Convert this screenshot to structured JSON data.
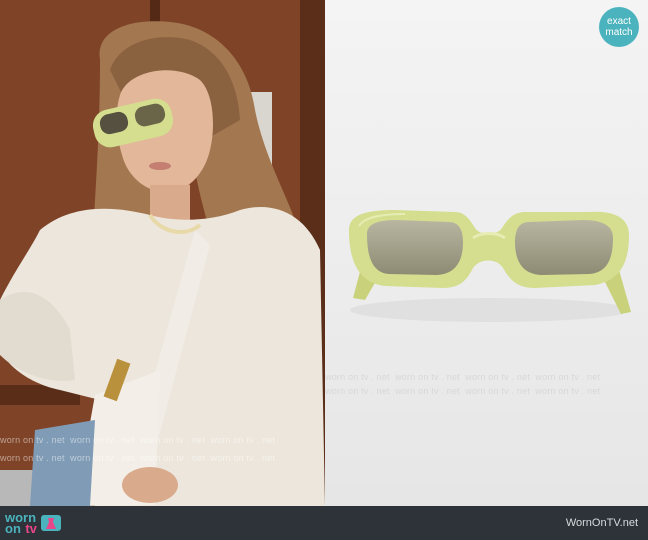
{
  "badge": {
    "line1": "exact",
    "line2": "match"
  },
  "watermark": {
    "text": "worn on tv . net"
  },
  "footer": {
    "logo_word1": "worn",
    "logo_word2": "on",
    "logo_word3": "tv",
    "site_name": "WornOnTV.net"
  },
  "colors": {
    "badge": "#4bb3bd",
    "footer_bg": "#2d3338",
    "frame_green": "#d4de8e",
    "lens_tint": "#9c9a82",
    "logo_pink": "#e8478b"
  }
}
